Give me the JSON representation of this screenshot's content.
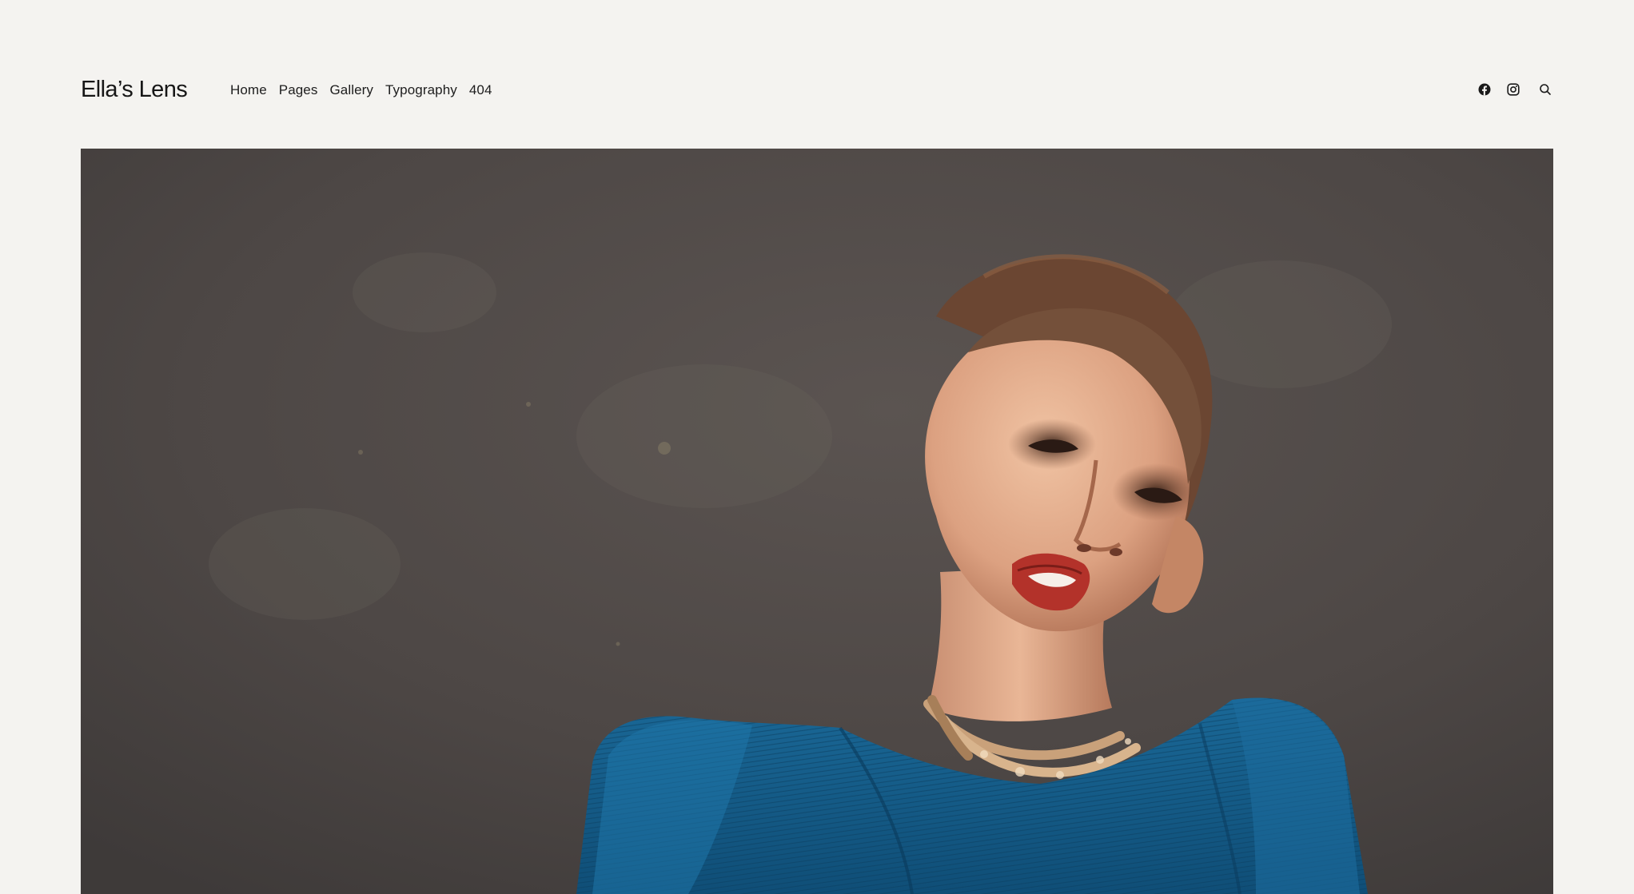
{
  "site": {
    "brand": "Ella’s Lens"
  },
  "nav": {
    "items": [
      {
        "label": "Home"
      },
      {
        "label": "Pages"
      },
      {
        "label": "Gallery"
      },
      {
        "label": "Typography"
      },
      {
        "label": "404"
      }
    ]
  },
  "header_icons": [
    {
      "icon": "facebook-icon"
    },
    {
      "icon": "instagram-icon"
    },
    {
      "icon": "search-icon"
    }
  ],
  "hero": {
    "subject": "fashion portrait photo",
    "colors": {
      "backdrop": "#4f4948",
      "garment": "#145a86",
      "skin": "#e2ad8c",
      "lips": "#b3322a",
      "necklace": "#c9a17a",
      "hair": "#6b4632"
    }
  },
  "colors": {
    "page_background": "#f4f3f0",
    "text": "#1a1a1a"
  }
}
